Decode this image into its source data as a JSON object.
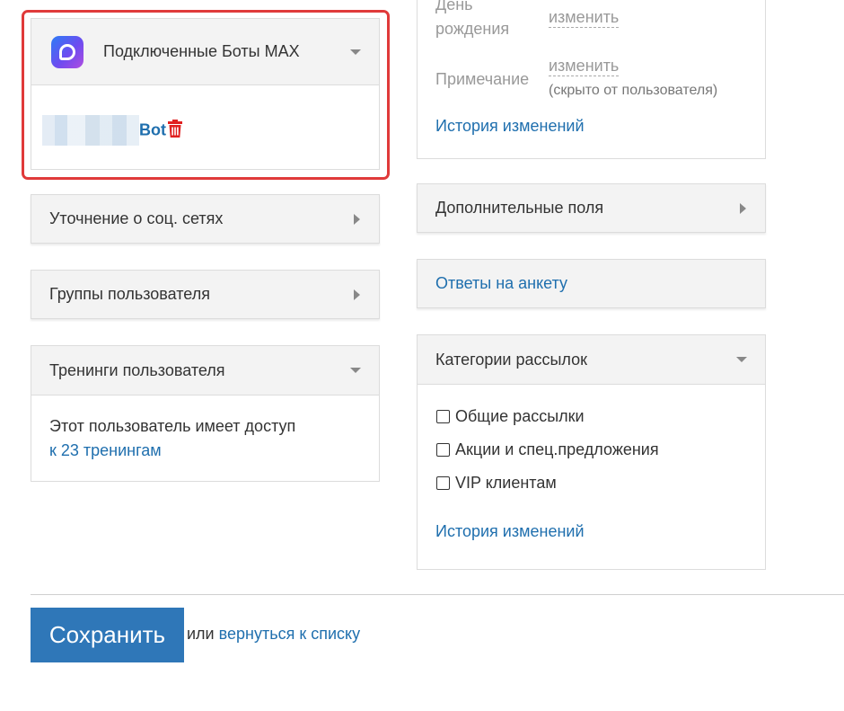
{
  "bots_panel": {
    "title": "Подключенные Боты MAX",
    "bot_suffix": "Bot",
    "logo_icon": "max-logo-icon",
    "delete_icon": "trash-icon"
  },
  "social_panel": {
    "title": "Уточнение о соц. сетях"
  },
  "groups_panel": {
    "title": "Группы пользователя"
  },
  "trainings_panel": {
    "title": "Тренинги пользователя",
    "text": "Этот пользователь имеет доступ",
    "link": "к 23 тренингам"
  },
  "profile": {
    "birthday_label_line1": "День",
    "birthday_label_line2": "рождения",
    "birthday_action": "изменить",
    "note_label": "Примечание",
    "note_action": "изменить",
    "note_hint": "(скрыто от пользователя)",
    "history_link": "История изменений"
  },
  "extra_fields_panel": {
    "title": "Дополнительные поля"
  },
  "survey_panel": {
    "title": "Ответы на анкету"
  },
  "mailing_panel": {
    "title": "Категории рассылок",
    "options": [
      "Общие рассылки",
      "Акции и спец.предложения",
      "VIP клиентам"
    ],
    "history_link": "История изменений"
  },
  "footer": {
    "save_label": "Сохранить",
    "or_text": "или",
    "back_link": "вернуться к списку"
  },
  "colors": {
    "accent": "#2f77b8",
    "link": "#1f6fae",
    "highlight": "#e03a3a",
    "delete": "#e02020"
  }
}
